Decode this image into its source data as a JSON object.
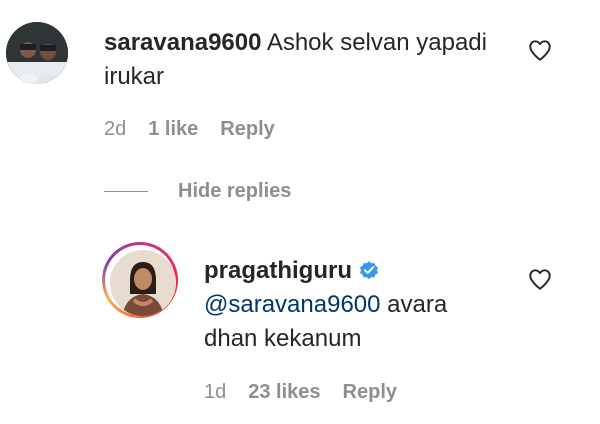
{
  "comments": [
    {
      "username": "saravana9600",
      "text": "Ashok selvan yapadi irukar",
      "time": "2d",
      "likes": "1 like",
      "reply_label": "Reply",
      "avatar_icon": "avatar-photo-two-people"
    },
    {
      "username": "pragathiguru",
      "verified": true,
      "mention": "@saravana9600",
      "text": "avara dhan kekanum",
      "time": "1d",
      "likes": "23 likes",
      "reply_label": "Reply",
      "avatar_icon": "avatar-photo-woman",
      "story_ring": true
    }
  ],
  "replies_toggle": {
    "label": "Hide replies"
  },
  "colors": {
    "text": "#262626",
    "muted": "#8e8e8e",
    "mention": "#00376b",
    "verified": "#3897f0"
  }
}
